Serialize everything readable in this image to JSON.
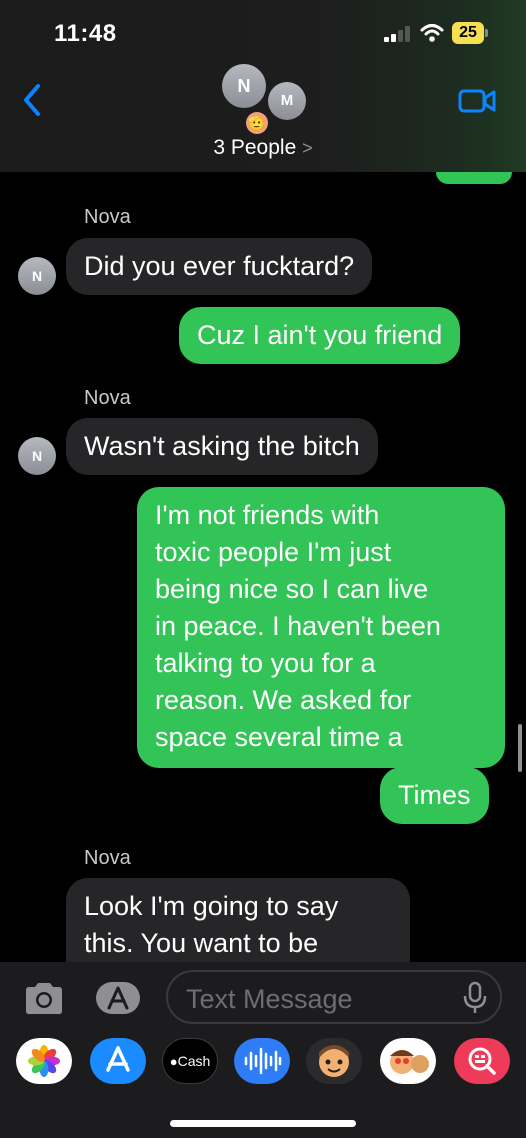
{
  "status_bar": {
    "time": "11:48",
    "battery": "25"
  },
  "header": {
    "group_label": "3 People",
    "chevron": ">",
    "avatars": [
      "N",
      "M"
    ],
    "avatar_emoji": "🫡"
  },
  "messages": [
    {
      "sender": "Nova",
      "avatar": "N",
      "text": "Did you ever fucktard?"
    },
    {
      "text": "Cuz I ain't you friend"
    },
    {
      "sender": "Nova",
      "avatar": "N",
      "text": "Wasn't asking the bitch"
    },
    {
      "lines": [
        "I'm not friends with",
        "toxic people I'm just",
        "being nice so I can live",
        "in peace. I haven't been",
        "talking to you for a",
        "reason. We asked for",
        "space several time a"
      ]
    },
    {
      "text": "Times"
    },
    {
      "sender": "Nova",
      "lines": [
        "Look I'm going to say",
        "this. You want to be"
      ]
    }
  ],
  "input": {
    "placeholder": "Text Message"
  },
  "apps": [
    {
      "icon": "photos-icon"
    },
    {
      "icon": "app-store-icon"
    },
    {
      "icon": "apple-cash-icon",
      "label": "Cash"
    },
    {
      "icon": "audio-message-icon"
    },
    {
      "icon": "memoji-icon"
    },
    {
      "icon": "memoji-stickers-icon"
    },
    {
      "icon": "search-images-icon"
    }
  ],
  "colors": {
    "outgoing": "#33c458",
    "incoming": "#262628",
    "accent": "#0a84ff"
  }
}
